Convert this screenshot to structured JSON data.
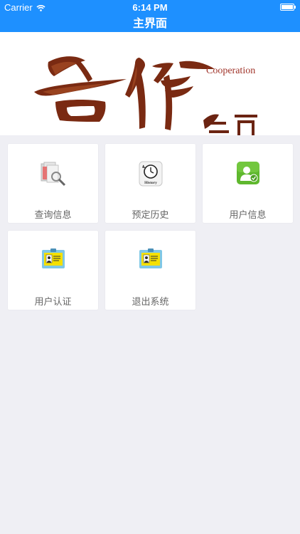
{
  "status_bar": {
    "carrier": "Carrier",
    "time": "6:14 PM"
  },
  "nav": {
    "title": "主界面"
  },
  "banner": {
    "caption": "Cooperation",
    "calligraphy": "合作共赢"
  },
  "tiles": [
    {
      "label": "查询信息",
      "icon": "search-documents-icon"
    },
    {
      "label": "预定历史",
      "icon": "history-icon",
      "icon_text": "History"
    },
    {
      "label": "用户信息",
      "icon": "user-info-icon"
    },
    {
      "label": "用户认证",
      "icon": "id-card-icon"
    },
    {
      "label": "退出系统",
      "icon": "id-card-icon"
    }
  ],
  "colors": {
    "nav": "#1e90ff",
    "background": "#efeff4",
    "user_icon_green": "#5fb82e",
    "id_card_yellow": "#f5e000"
  }
}
